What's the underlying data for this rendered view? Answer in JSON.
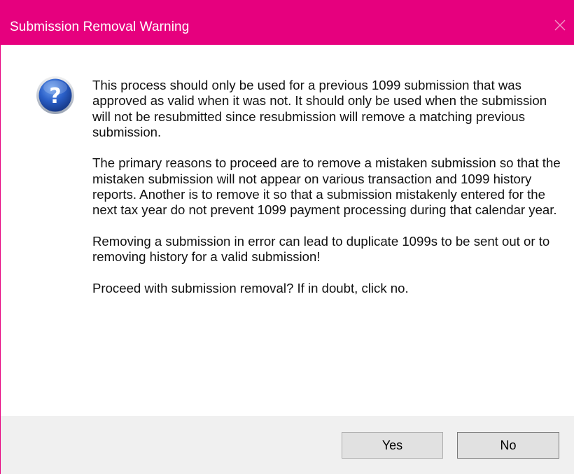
{
  "dialog": {
    "title": "Submission Removal Warning",
    "close_icon": "close-icon",
    "icon": "question-icon",
    "paragraphs": [
      "This process should only be used for a previous 1099 submission that was approved as valid when it was not.  It should only be used when the submission will not be resubmitted since resubmission will remove a matching previous submission.",
      "The primary reasons to proceed are to remove a mistaken submission so that the mistaken submission will not appear on various transaction and 1099 history reports.  Another is to remove it so that a submission mistakenly entered for the next tax year do not prevent 1099 payment processing during that calendar year.",
      "Removing a submission in error can lead to duplicate 1099s to be sent out or to removing history for a valid submission!",
      "Proceed with submission removal?  If in doubt, click no."
    ],
    "buttons": {
      "yes_label": "Yes",
      "no_label": "No"
    }
  },
  "colors": {
    "titlebar": "#e6007e",
    "footer": "#f0f0f0",
    "button_face": "#e1e1e1",
    "icon_blue": "#1f4fb0"
  }
}
